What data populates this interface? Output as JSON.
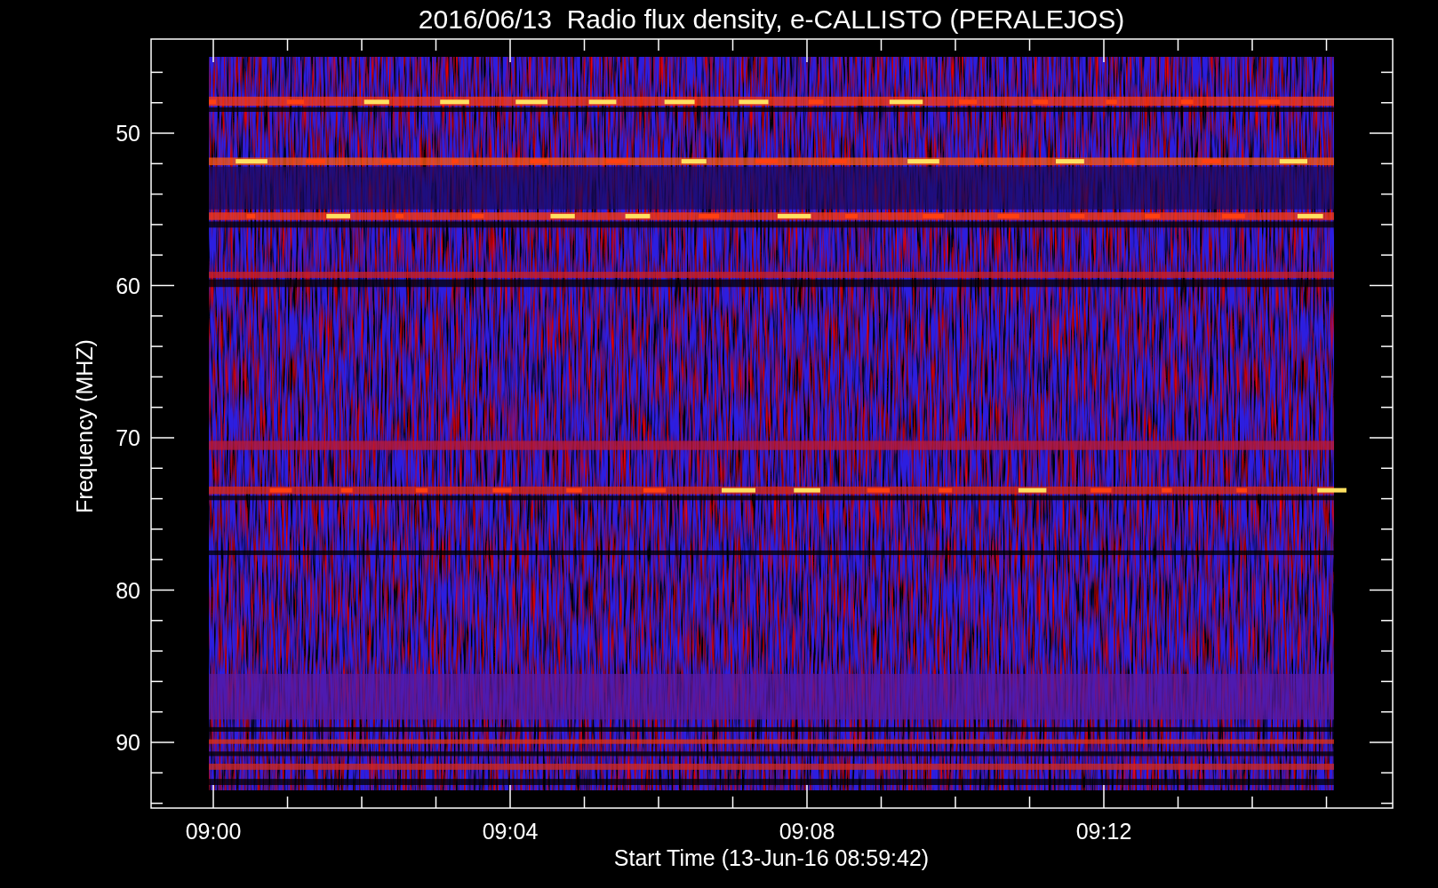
{
  "title": "2016/06/13  Radio flux density, e-CALLISTO (PERALEJOS)",
  "y_axis": {
    "label": "Frequency (MHZ)",
    "ticks": [
      "50",
      "60",
      "70",
      "80",
      "90"
    ]
  },
  "x_axis": {
    "label": "Start Time (13-Jun-16 08:59:42)",
    "ticks": [
      "09:00",
      "09:04",
      "09:08",
      "09:12"
    ]
  }
}
